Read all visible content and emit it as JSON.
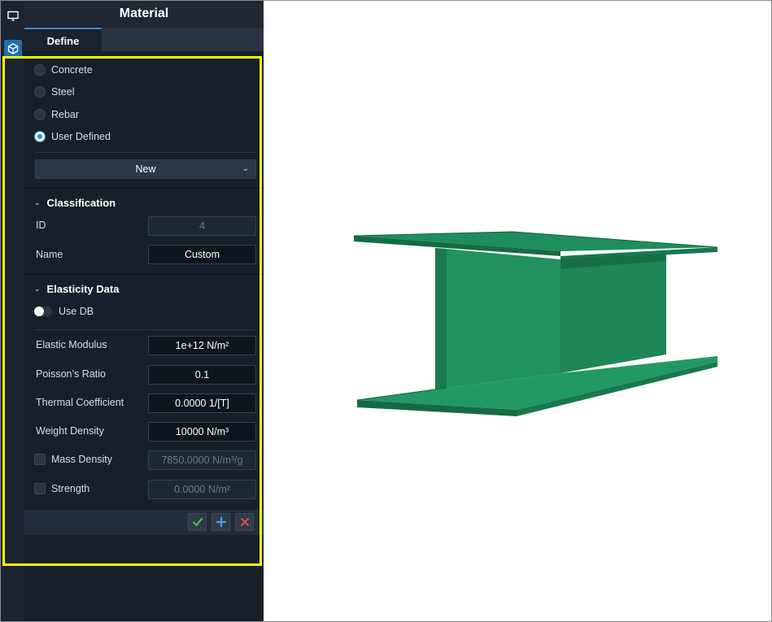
{
  "panel": {
    "title": "Material",
    "tabs": [
      {
        "label": "Define",
        "active": true
      }
    ]
  },
  "material_types": [
    {
      "label": "Concrete",
      "selected": false
    },
    {
      "label": "Steel",
      "selected": false
    },
    {
      "label": "Rebar",
      "selected": false
    },
    {
      "label": "User Defined",
      "selected": true
    }
  ],
  "material_select": {
    "value": "New"
  },
  "classification": {
    "title": "Classification",
    "id_label": "ID",
    "id_value": "4",
    "name_label": "Name",
    "name_value": "Custom"
  },
  "elasticity": {
    "title": "Elasticity Data",
    "use_db_label": "Use DB",
    "use_db_on": false,
    "elastic_modulus_label": "Elastic Modulus",
    "elastic_modulus_value": "1e+12 N/m²",
    "poisson_label": "Poisson’s Ratio",
    "poisson_value": "0.1",
    "thermal_label": "Thermal Coefficient",
    "thermal_value": "0.0000 1/[T]",
    "weight_density_label": "Weight Density",
    "weight_density_value": "10000 N/m³",
    "mass_density_label": "Mass Density",
    "mass_density_value": "7850.0000 N/m³/g",
    "strength_label": "Strength",
    "strength_value": "0.0000 N/m²"
  },
  "icons": {
    "rail_top": "screen-icon",
    "rail_active": "cube-icon",
    "footer": [
      "check-icon",
      "plus-icon",
      "close-icon"
    ]
  },
  "colors": {
    "accent": "#2f8fe0",
    "highlight": "#ffff00",
    "beam": "#1f8a5a",
    "confirm": "#5cc25c",
    "add": "#3aa0ff",
    "delete": "#e04a4a"
  }
}
